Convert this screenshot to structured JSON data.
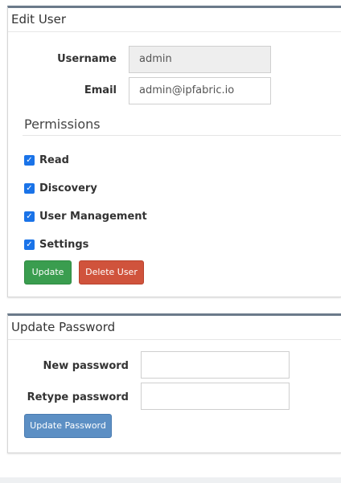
{
  "edit_user": {
    "title": "Edit User",
    "username_label": "Username",
    "username_value": "admin",
    "email_label": "Email",
    "email_value": "admin@ipfabric.io",
    "permissions_title": "Permissions",
    "permissions": [
      {
        "label": "Read",
        "checked": true
      },
      {
        "label": "Discovery",
        "checked": true
      },
      {
        "label": "User Management",
        "checked": true
      },
      {
        "label": "Settings",
        "checked": true
      }
    ],
    "update_button": "Update",
    "delete_button": "Delete User"
  },
  "update_password": {
    "title": "Update Password",
    "new_password_label": "New password",
    "new_password_value": "",
    "retype_password_label": "Retype password",
    "retype_password_value": "",
    "update_password_button": "Update Password"
  },
  "colors": {
    "checkbox": "#1a73e8",
    "update_button": "#3a9d4f",
    "delete_button": "#d0533c",
    "update_password_button": "#5c8fc4"
  },
  "icons": {
    "checkbox_check": "check-icon"
  }
}
